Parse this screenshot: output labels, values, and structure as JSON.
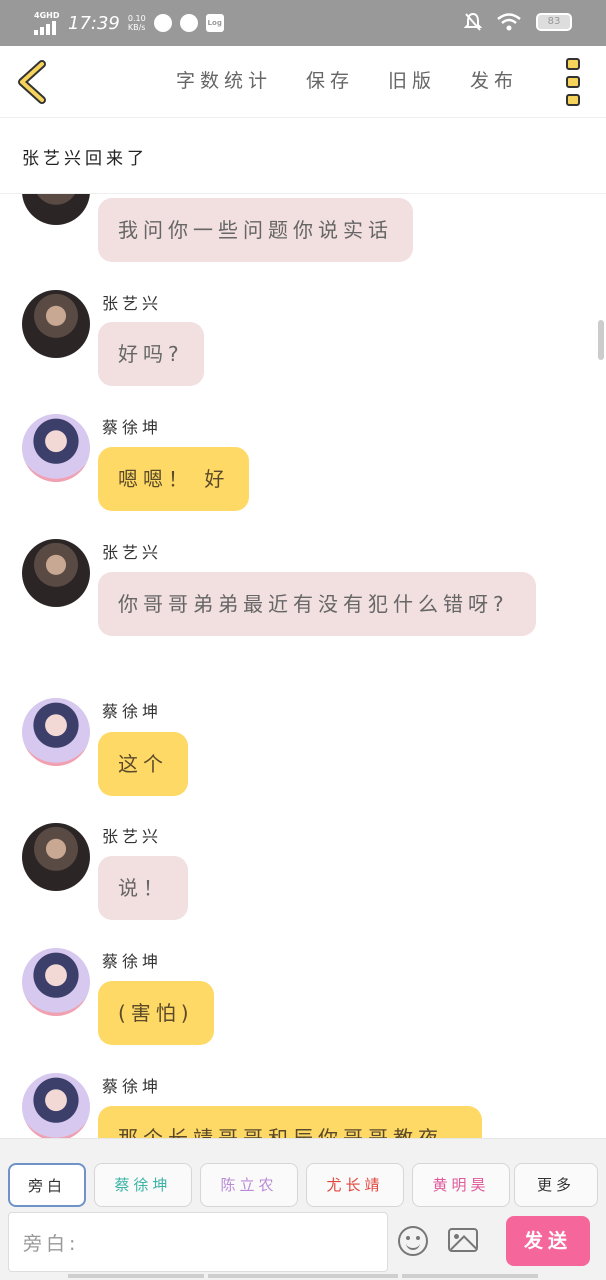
{
  "status_bar": {
    "network": "4GHD",
    "time": "17:39",
    "speed_value": "0.10",
    "speed_unit": "KB/s",
    "app_icon_label": "Log",
    "battery": "83"
  },
  "top_bar": {
    "actions": [
      "字数统计",
      "保存",
      "旧版",
      "发布"
    ]
  },
  "title": "张艺兴回来了",
  "messages": [
    {
      "speaker": "",
      "text": "我问你一些问题你说实话",
      "style": "pink",
      "avatar": "zhang"
    },
    {
      "speaker": "张艺兴",
      "text": "好吗?",
      "style": "pink",
      "avatar": "zhang"
    },
    {
      "speaker": "蔡徐坤",
      "text": "嗯嗯！ 好",
      "style": "yellow",
      "avatar": "cai"
    },
    {
      "speaker": "张艺兴",
      "text": "你哥哥弟弟最近有没有犯什么错呀?",
      "style": "pink",
      "avatar": "zhang"
    },
    {
      "speaker": "蔡徐坤",
      "text": "这个",
      "style": "yellow",
      "avatar": "cai"
    },
    {
      "speaker": "张艺兴",
      "text": "说！",
      "style": "pink",
      "avatar": "zhang"
    },
    {
      "speaker": "蔡徐坤",
      "text": "(害怕)",
      "style": "yellow",
      "avatar": "cai"
    },
    {
      "speaker": "蔡徐坤",
      "text": "那个长靖哥哥和辰你哥哥教夜",
      "style": "yellow",
      "avatar": "cai"
    }
  ],
  "roles": [
    {
      "label": "旁白",
      "color": "#555555"
    },
    {
      "label": "蔡徐坤",
      "color": "#3bb3a6"
    },
    {
      "label": "陈立农",
      "color": "#b98ad6"
    },
    {
      "label": "尤长靖",
      "color": "#e0483e"
    },
    {
      "label": "黄明昊",
      "color": "#e05a9a"
    },
    {
      "label": "更多",
      "color": "#555555"
    }
  ],
  "composer": {
    "placeholder": "旁白:",
    "send_label": "发送"
  },
  "colors": {
    "accent": "#f5669b",
    "bubble_pink": "#f2dfe0",
    "bubble_yellow": "#ffd966"
  }
}
